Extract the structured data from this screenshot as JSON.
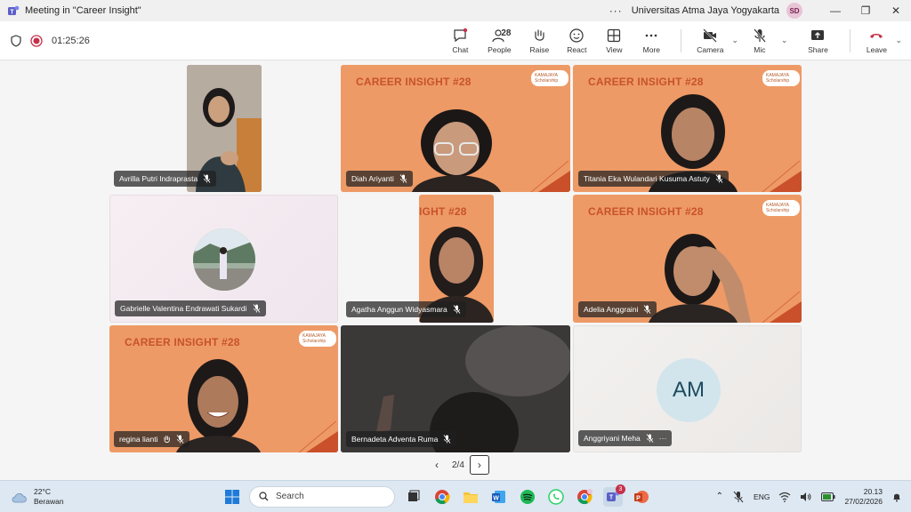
{
  "window": {
    "title": "Meeting in \"Career Insight\"",
    "more": "···",
    "org": "Universitas Atma Jaya Yogyakarta",
    "user_initials": "SD",
    "minimize": "—",
    "restore": "❐",
    "close": "✕"
  },
  "toolbar": {
    "timer": "01:25:26",
    "chat": "Chat",
    "people": "People",
    "people_count": "28",
    "raise": "Raise",
    "react": "React",
    "view": "View",
    "more": "More",
    "camera": "Camera",
    "mic": "Mic",
    "share": "Share",
    "leave": "Leave"
  },
  "banner_text": "CAREER INSIGHT #28",
  "banner_short": "IGHT #28",
  "logo_text": "KAMAJAYA Scholarship",
  "participants": [
    {
      "name": "Avrilla Putri Indraprasta"
    },
    {
      "name": "Diah Ariyanti"
    },
    {
      "name": "Titania Eka Wulandari Kusuma Astuty"
    },
    {
      "name": "Gabrielle Valentina Endrawati Sukardi"
    },
    {
      "name": "Agatha Anggun Widyasmara"
    },
    {
      "name": "Adelia Anggraini"
    },
    {
      "name": "regina lianti"
    },
    {
      "name": "Bernadeta Adventa Ruma"
    },
    {
      "name": "Anggriyani Meha",
      "initials": "AM",
      "more": "···"
    }
  ],
  "pager": {
    "label": "2/4",
    "prev": "‹",
    "next": "›"
  },
  "taskbar": {
    "temperature": "22°C",
    "condition": "Berawan",
    "search_placeholder": "Search",
    "teams_badge": "3",
    "language": "ENG",
    "time": "20.13",
    "date": "27/02/2026"
  },
  "colors": {
    "orange_bg": "#ee9a66",
    "banner_text": "#c7532a",
    "leave_red": "#c4314b",
    "teams_purple": "#5b5fc7"
  }
}
